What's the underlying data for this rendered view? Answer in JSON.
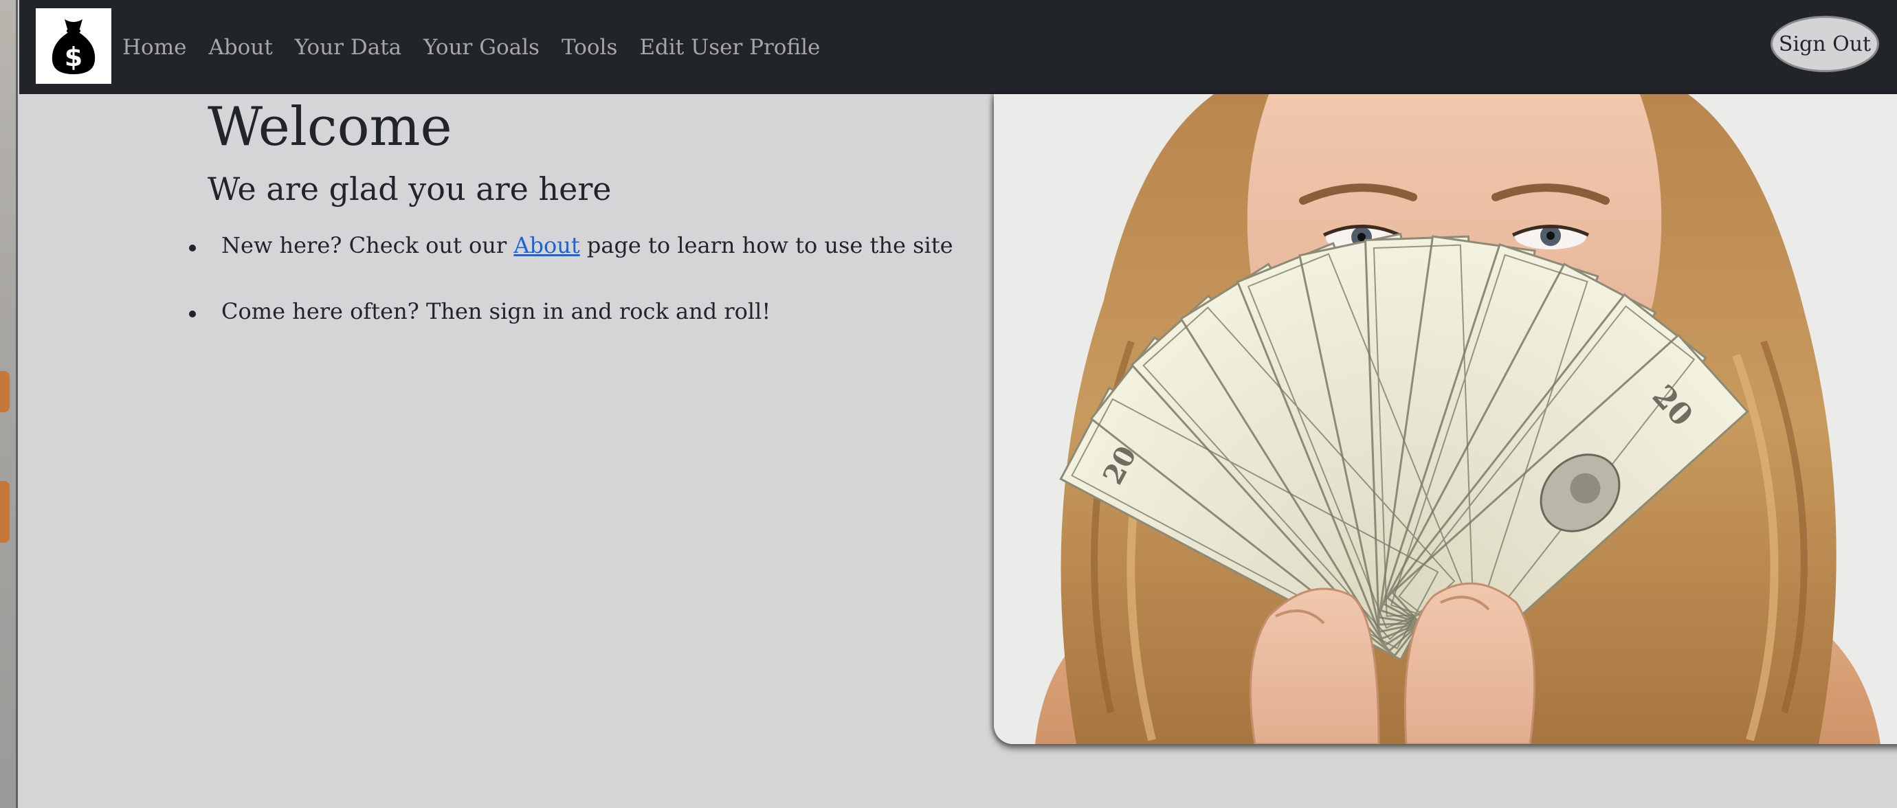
{
  "navbar": {
    "logo_icon": "money-bag-icon",
    "links": [
      "Home",
      "About",
      "Your Data",
      "Your Goals",
      "Tools",
      "Edit User Profile"
    ],
    "sign_out_label": "Sign Out"
  },
  "main": {
    "title": "Welcome",
    "subtitle": "We are glad you are here",
    "bullets": [
      {
        "before": "New here? Check out our ",
        "link": "About",
        "after": " page to learn how to use the site"
      },
      {
        "text": "Come here often? Then sign in and rock and roll!"
      }
    ]
  },
  "hero_image": {
    "icon": "woman-holding-dollar-bills-photo"
  },
  "colors": {
    "navbar": "#212529",
    "page_background": "#d5d5d7",
    "nav_link": "#a5a7aa",
    "link": "#1d63d6",
    "text": "#212529"
  }
}
